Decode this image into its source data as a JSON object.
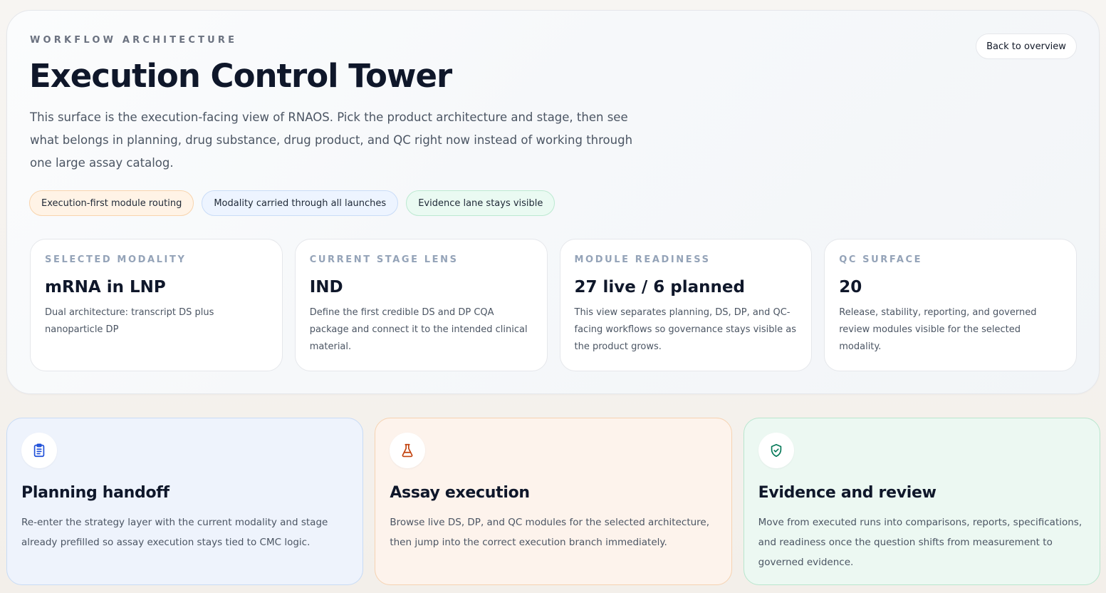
{
  "hero": {
    "eyebrow": "WORKFLOW ARCHITECTURE",
    "title": "Execution Control Tower",
    "description": "This surface is the execution-facing view of RNAOS. Pick the product architecture and stage, then see what belongs in planning, drug substance, drug product, and QC right now instead of working through one large assay catalog.",
    "back_button": "Back to overview",
    "pills": [
      {
        "label": "Execution-first module routing",
        "color": "#fff3e6"
      },
      {
        "label": "Modality carried through all launches",
        "color": "#edf4ff"
      },
      {
        "label": "Evidence lane stays visible",
        "color": "#eafaf2"
      }
    ]
  },
  "stats": [
    {
      "label": "SELECTED MODALITY",
      "value": "mRNA in LNP",
      "description": "Dual architecture: transcript DS plus nanoparticle DP"
    },
    {
      "label": "CURRENT STAGE LENS",
      "value": "IND",
      "description": "Define the first credible DS and DP CQA package and connect it to the intended clinical material."
    },
    {
      "label": "MODULE READINESS",
      "value": "27 live / 6 planned",
      "description": "This view separates planning, DS, DP, and QC-facing workflows so governance stays visible as the product grows."
    },
    {
      "label": "QC SURFACE",
      "value": "20",
      "description": "Release, stability, reporting, and governed review modules visible for the selected modality."
    }
  ],
  "cards": [
    {
      "icon": "clipboard-icon",
      "title": "Planning handoff",
      "description": "Re-enter the strategy layer with the current modality and stage already prefilled so assay execution stays tied to CMC logic.",
      "accent": "#1d4ed8"
    },
    {
      "icon": "flask-icon",
      "title": "Assay execution",
      "description": "Browse live DS, DP, and QC modules for the selected architecture, then jump into the correct execution branch immediately.",
      "accent": "#c2410c"
    },
    {
      "icon": "shield-check-icon",
      "title": "Evidence and review",
      "description": "Move from executed runs into comparisons, reports, specifications, and readiness once the question shifts from measurement to governed evidence.",
      "accent": "#047857"
    }
  ]
}
